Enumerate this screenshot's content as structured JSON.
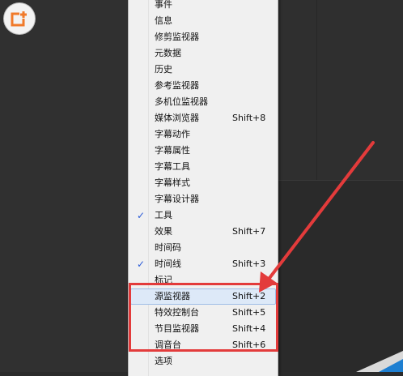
{
  "menu": {
    "items": [
      {
        "label": "事件",
        "shortcut": "",
        "checked": false
      },
      {
        "label": "信息",
        "shortcut": "",
        "checked": false
      },
      {
        "label": "修剪监视器",
        "shortcut": "",
        "checked": false
      },
      {
        "label": "元数据",
        "shortcut": "",
        "checked": false
      },
      {
        "label": "历史",
        "shortcut": "",
        "checked": false
      },
      {
        "label": "参考监视器",
        "shortcut": "",
        "checked": false
      },
      {
        "label": "多机位监视器",
        "shortcut": "",
        "checked": false
      },
      {
        "label": "媒体浏览器",
        "shortcut": "Shift+8",
        "checked": false
      },
      {
        "label": "字幕动作",
        "shortcut": "",
        "checked": false
      },
      {
        "label": "字幕属性",
        "shortcut": "",
        "checked": false
      },
      {
        "label": "字幕工具",
        "shortcut": "",
        "checked": false
      },
      {
        "label": "字幕样式",
        "shortcut": "",
        "checked": false
      },
      {
        "label": "字幕设计器",
        "shortcut": "",
        "checked": false
      },
      {
        "label": "工具",
        "shortcut": "",
        "checked": true
      },
      {
        "label": "效果",
        "shortcut": "Shift+7",
        "checked": false
      },
      {
        "label": "时间码",
        "shortcut": "",
        "checked": false
      },
      {
        "label": "时间线",
        "shortcut": "Shift+3",
        "checked": true
      },
      {
        "label": "标记",
        "shortcut": "",
        "checked": false
      },
      {
        "label": "源监视器",
        "shortcut": "Shift+2",
        "checked": false,
        "hover": true
      },
      {
        "label": "特效控制台",
        "shortcut": "Shift+5",
        "checked": false
      },
      {
        "label": "节目监视器",
        "shortcut": "Shift+4",
        "checked": false
      },
      {
        "label": "调音台",
        "shortcut": "Shift+6",
        "checked": false
      },
      {
        "label": "选项",
        "shortcut": "",
        "checked": false
      }
    ]
  },
  "colors": {
    "annotation_red": "#e33b3b",
    "check_blue": "#2a5bd7",
    "menu_bg": "#f0f0f0",
    "hover_bg": "#dde9f8"
  },
  "icons": {
    "logo": "add-window-icon",
    "check": "check-icon"
  }
}
